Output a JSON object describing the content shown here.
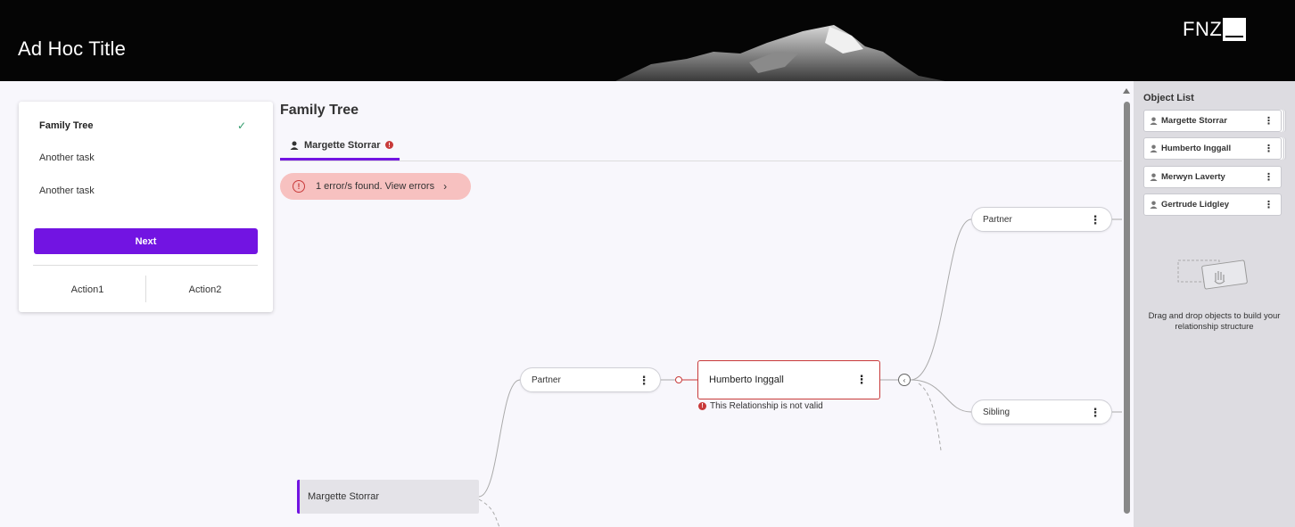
{
  "header": {
    "title": "Ad Hoc Title",
    "logo_text": "FNZ"
  },
  "tasks": {
    "items": [
      {
        "label": "Family Tree",
        "completed": true
      },
      {
        "label": "Another task",
        "completed": false
      },
      {
        "label": "Another task",
        "completed": false
      }
    ],
    "next_label": "Next",
    "action1_label": "Action1",
    "action2_label": "Action2"
  },
  "main": {
    "title": "Family Tree",
    "tab_label": "Margette Storrar",
    "error_text": "1 error/s found.  View errors"
  },
  "tree": {
    "root": "Margette Storrar",
    "partner_left": "Partner",
    "center": "Humberto Inggall",
    "center_error": "This Relationship is not valid",
    "partner_right": "Partner",
    "sibling": "Sibling"
  },
  "object_list": {
    "title": "Object List",
    "items": [
      {
        "name": "Margette Storrar",
        "stacked": true
      },
      {
        "name": "Humberto Inggall",
        "stacked": true
      },
      {
        "name": "Merwyn Laverty",
        "stacked": false
      },
      {
        "name": "Gertrude Lidgley",
        "stacked": false
      }
    ],
    "empty_hint": "Drag and drop objects to build your relationship structure"
  },
  "colors": {
    "accent": "#7214e2",
    "error": "#c83a3a",
    "error_bg": "#f7c1c0",
    "success": "#2e9a6a"
  },
  "icons": [
    "person-icon",
    "check-icon",
    "error-icon",
    "kebab-icon",
    "chevron-right-icon",
    "collapse-icon",
    "drag-drop-icon"
  ]
}
